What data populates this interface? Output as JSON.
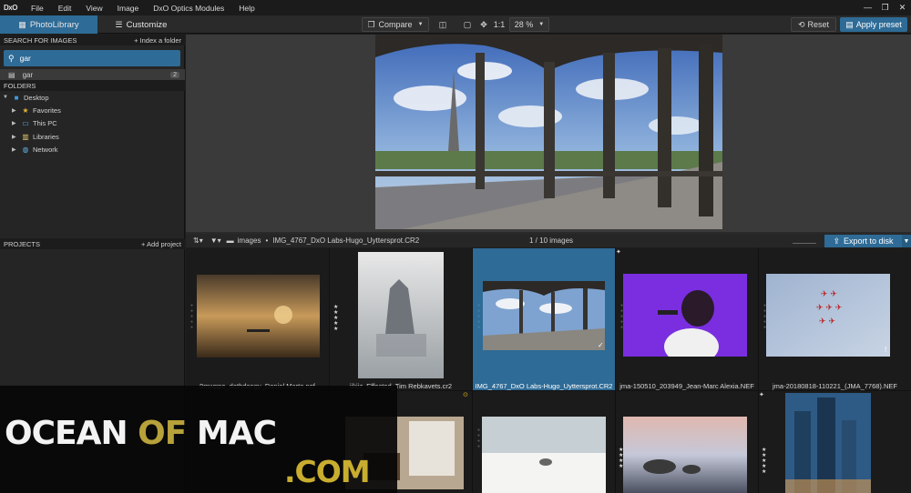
{
  "app": {
    "logo": "DxO"
  },
  "menu": [
    "File",
    "Edit",
    "View",
    "Image",
    "DxO Optics Modules",
    "Help"
  ],
  "window_controls": {
    "minimize": "—",
    "restore": "❐",
    "close": "✕"
  },
  "toolbar": {
    "tabs": [
      {
        "label": "PhotoLibrary"
      },
      {
        "label": "Customize"
      }
    ],
    "compare_label": "Compare",
    "one_to_one": "1:1",
    "zoom": "28 %",
    "reset_label": "Reset",
    "apply_preset_label": "Apply preset"
  },
  "search": {
    "header": "SEARCH FOR IMAGES",
    "index_action": "+ Index a folder",
    "query": "gar",
    "result_label": "gar",
    "result_count": "2"
  },
  "folders": {
    "header": "FOLDERS",
    "items": [
      {
        "label": "Desktop"
      },
      {
        "label": "Favorites"
      },
      {
        "label": "This PC"
      },
      {
        "label": "Libraries"
      },
      {
        "label": "Network"
      }
    ]
  },
  "projects": {
    "header": "PROJECTS",
    "add_action": "+ Add project"
  },
  "filmstrip": {
    "folder": "images",
    "separator": "•",
    "current_file": "IMG_4767_DxO Labs-Hugo_Uyttersprot.CR2",
    "count": "1 / 10  images",
    "export_label": "Export to disk"
  },
  "thumbnails": [
    {
      "caption": "9mwppo_dethdangy_Daniel Marto.nef",
      "stars": 0,
      "selected": false
    },
    {
      "caption": "iikiiz_Effected_Tim Rebkavets.cr2",
      "stars": 5,
      "selected": false
    },
    {
      "caption": "IMG_4767_DxO Labs-Hugo_Uyttersprot.CR2",
      "stars": 0,
      "selected": true
    },
    {
      "caption": "jma-150510_203949_Jean-Marc Alexia.NEF",
      "stars": 0,
      "selected": false
    },
    {
      "caption": "jma-20180818-110221_(JMA_7768).NEF",
      "stars": 0,
      "selected": false
    },
    {
      "caption": "",
      "stars": 0,
      "selected": false
    },
    {
      "caption": "",
      "stars": 0,
      "selected": false
    },
    {
      "caption": "",
      "stars": 0,
      "selected": false
    },
    {
      "caption": "",
      "stars": 4,
      "selected": false
    },
    {
      "caption": "",
      "stars": 5,
      "selected": false
    }
  ],
  "watermark": {
    "ocean": "OCEAN",
    "of": "OF",
    "mac": "MAC",
    "com": ".COM"
  },
  "colors": {
    "accent": "#2e6b96",
    "panel": "#252525",
    "gold": "#c8ad2f"
  }
}
